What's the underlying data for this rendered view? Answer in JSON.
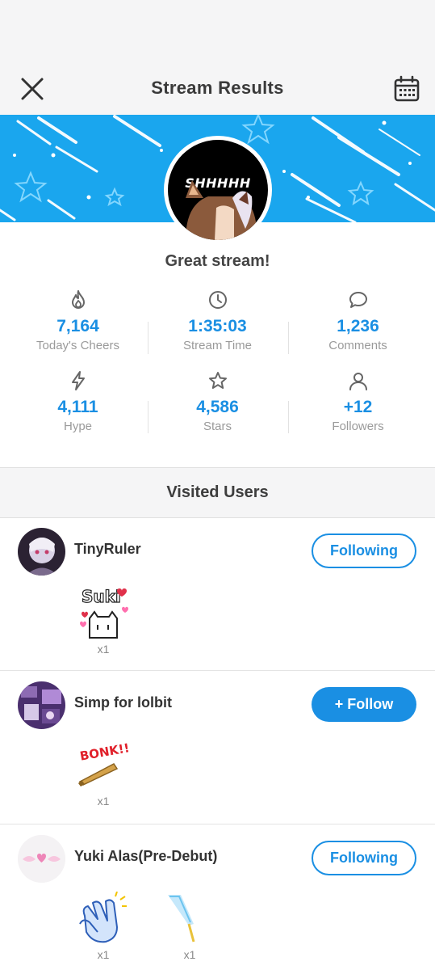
{
  "header": {
    "title": "Stream Results",
    "close_icon": "close-icon",
    "calendar_icon": "calendar-icon"
  },
  "profile": {
    "avatar_text": "SHHHHH",
    "headline": "Great stream!"
  },
  "stats": [
    {
      "icon": "flame-icon",
      "value": "7,164",
      "label": "Today's Cheers"
    },
    {
      "icon": "clock-icon",
      "value": "1:35:03",
      "label": "Stream Time"
    },
    {
      "icon": "comment-icon",
      "value": "1,236",
      "label": "Comments"
    },
    {
      "icon": "lightning-icon",
      "value": "4,111",
      "label": "Hype"
    },
    {
      "icon": "star-icon",
      "value": "4,586",
      "label": "Stars"
    },
    {
      "icon": "user-icon",
      "value": "+12",
      "label": "Followers"
    }
  ],
  "visited": {
    "title": "Visited Users",
    "users": [
      {
        "name": "TinyRuler",
        "button": "Following",
        "gifts": [
          {
            "icon": "suki-cat-sticker-icon",
            "text": "Suki",
            "qty": "x1"
          }
        ]
      },
      {
        "name": "Simp for lolbit",
        "button": "+ Follow",
        "gifts": [
          {
            "icon": "bonk-bat-sticker-icon",
            "text": "BONK!!",
            "qty": "x1"
          }
        ]
      },
      {
        "name": "Yuki Alas(Pre-Debut)",
        "button": "Following",
        "gifts": [
          {
            "icon": "clapping-hands-icon",
            "qty": "x1"
          },
          {
            "icon": "glow-stick-icon",
            "qty": "x1"
          }
        ]
      }
    ]
  },
  "colors": {
    "accent": "#1a8fe3",
    "banner": "#1aa6ee",
    "header_bg": "#f5f5f6"
  }
}
